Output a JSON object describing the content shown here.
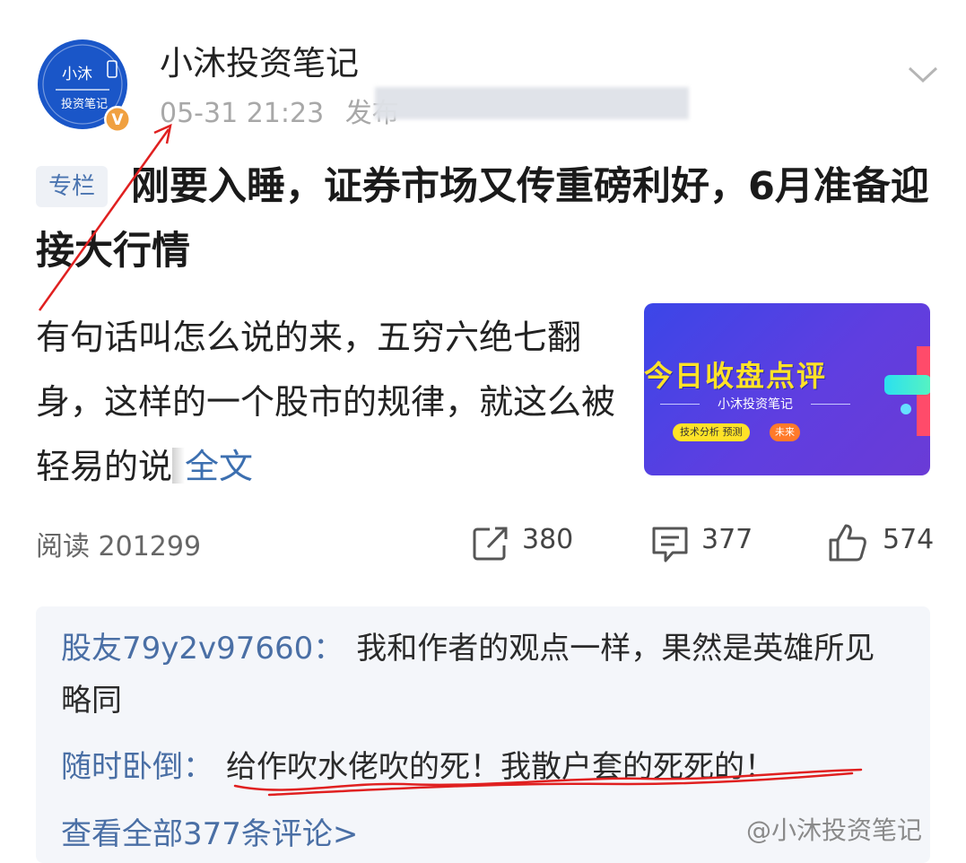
{
  "post": {
    "avatar_text_top": "小沐",
    "avatar_text_bottom": "投资笔记",
    "verified_badge": "V",
    "author": "小沐投资笔记",
    "timestamp": "05-31 21:23",
    "published_label": "发布",
    "tag": "专栏",
    "title": "刚要入睡，证券市场又传重磅利好，6月准备迎接大行情",
    "summary": "有句话叫怎么说的来，五穷六绝七翻身，这样的一个股市的规律，就这么被轻易的说",
    "more_label": "全文",
    "thumbnail": {
      "headline": "今日收盘点评",
      "subtitle": "小沐投资笔记",
      "chip1": "技术分析  预测",
      "chip2": "未来"
    }
  },
  "stats": {
    "read_label": "阅读",
    "read_count": "201299",
    "share_count": "380",
    "comment_count": "377",
    "like_count": "574"
  },
  "comments": {
    "items": [
      {
        "user": "股友79y2v97660：",
        "text": "我和作者的观点一样，果然是英雄所见略同"
      },
      {
        "user": "随时卧倒：",
        "text": "给作吹水佬吹的死！我散户套的死死的！"
      }
    ],
    "view_all": "查看全部377条评论>"
  },
  "watermark": "@小沐投资笔记",
  "colors": {
    "link": "#3c6fb0",
    "comment_user": "#4a6fa5",
    "annotation": "#e02020",
    "avatar_bg": "#1a56c8"
  }
}
